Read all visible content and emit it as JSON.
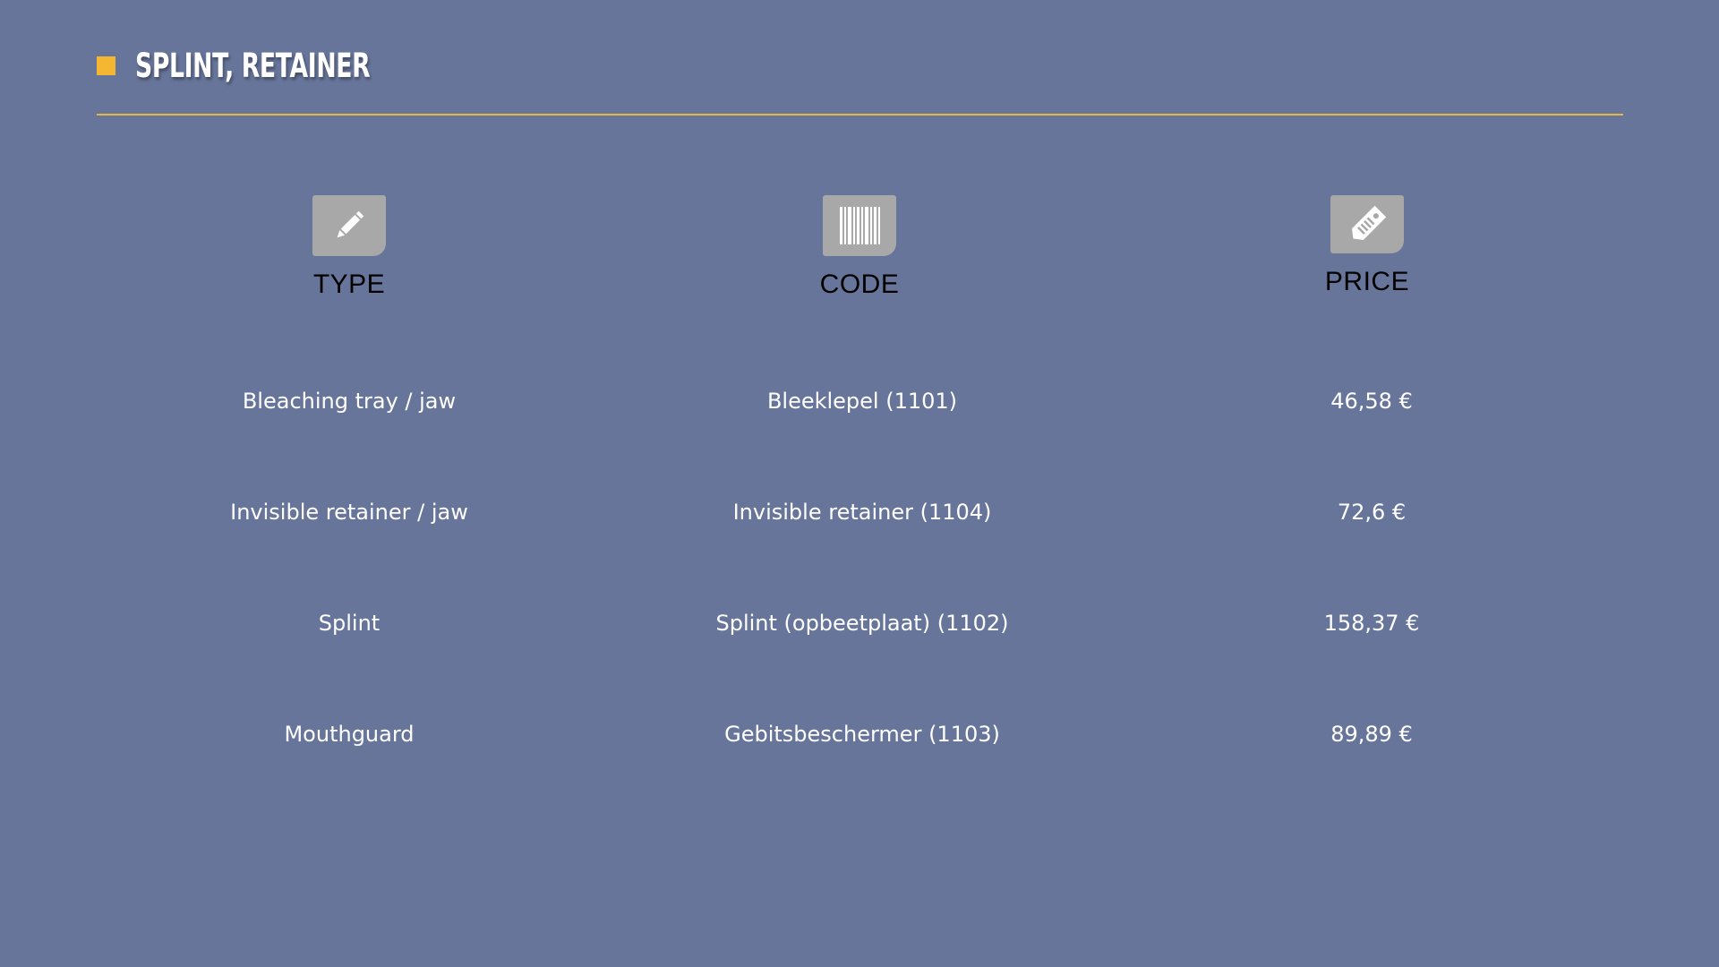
{
  "slide": {
    "title": "SPLINT, RETAINER",
    "accent_color": "#f5b731",
    "background_color": "#67759a"
  },
  "columns": [
    {
      "label": "TYPE",
      "icon": "pencil-icon"
    },
    {
      "label": "CODE",
      "icon": "barcode-icon"
    },
    {
      "label": "PRICE",
      "icon": "price-tag-icon"
    }
  ],
  "rows": [
    {
      "type": "Bleaching tray / jaw",
      "code": "Bleeklepel (1101)",
      "price": "46,58 €"
    },
    {
      "type": "Invisible retainer / jaw",
      "code": "Invisible retainer (1104)",
      "price": "72,6 €"
    },
    {
      "type": "Splint",
      "code": "Splint (opbeetplaat) (1102)",
      "price": "158,37 €"
    },
    {
      "type": "Mouthguard",
      "code": "Gebitsbeschermer (1103)",
      "price": "89,89 €"
    }
  ]
}
